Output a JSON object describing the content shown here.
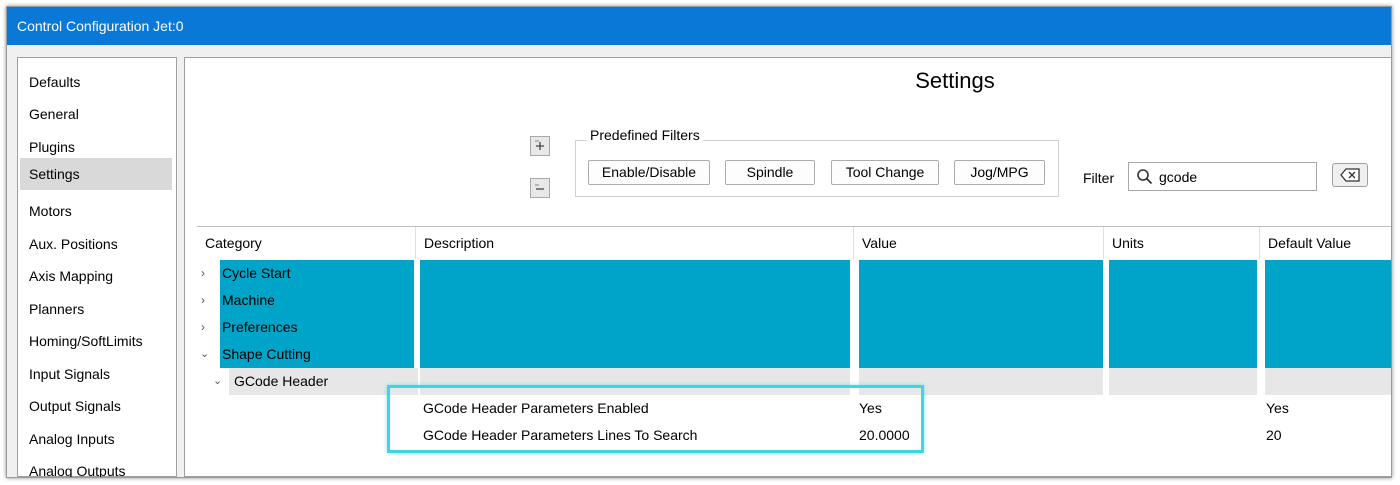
{
  "window": {
    "title": "Control Configuration Jet:0"
  },
  "sidebar": {
    "items": [
      {
        "label": "Defaults"
      },
      {
        "label": "General"
      },
      {
        "label": "Plugins"
      },
      {
        "label": "Settings"
      },
      {
        "label": "Motors"
      },
      {
        "label": "Aux. Positions"
      },
      {
        "label": "Axis Mapping"
      },
      {
        "label": "Planners"
      },
      {
        "label": "Homing/SoftLimits"
      },
      {
        "label": "Input Signals"
      },
      {
        "label": "Output Signals"
      },
      {
        "label": "Analog Inputs"
      },
      {
        "label": "Analog Outputs"
      }
    ],
    "selected": "Settings"
  },
  "main": {
    "title": "Settings",
    "expand_icon": "expand-all-icon",
    "collapse_icon": "collapse-all-icon",
    "predefined_filters": {
      "label": "Predefined Filters",
      "buttons": [
        {
          "label": "Enable/Disable"
        },
        {
          "label": "Spindle"
        },
        {
          "label": "Tool Change"
        },
        {
          "label": "Jog/MPG"
        }
      ]
    },
    "filter": {
      "label": "Filter",
      "value": "gcode",
      "icon": "search-icon",
      "clear_icon": "clear-input-icon"
    }
  },
  "grid": {
    "columns": [
      {
        "label": "Category"
      },
      {
        "label": "Description"
      },
      {
        "label": "Value"
      },
      {
        "label": "Units"
      },
      {
        "label": "Default Value"
      }
    ],
    "categories": [
      {
        "label": "Cycle Start",
        "expanded": false
      },
      {
        "label": "Machine",
        "expanded": false
      },
      {
        "label": "Preferences",
        "expanded": false
      },
      {
        "label": "Shape Cutting",
        "expanded": true
      }
    ],
    "subcategory": {
      "label": "GCode Header",
      "expanded": true
    },
    "rows": [
      {
        "description": "GCode Header Parameters Enabled",
        "value": "Yes",
        "units": "",
        "default": "Yes"
      },
      {
        "description": "GCode Header Parameters Lines To Search",
        "value": "20.0000",
        "units": "",
        "default": "20"
      }
    ],
    "colors": {
      "category_highlight": "#00a4c8",
      "subcategory_bg": "#e7e7e7",
      "callout_border": "#3fd5e5"
    }
  }
}
